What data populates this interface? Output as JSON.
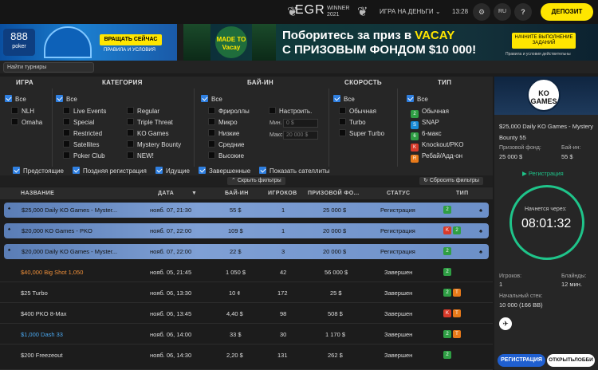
{
  "header": {
    "egr_title": "EGR",
    "egr_winner": "WINNER",
    "egr_year": "2021",
    "play_money": "ИГРА НА ДЕНЬГИ",
    "time": "13:28",
    "lang": "RU",
    "help": "?",
    "deposit": "ДЕПОЗИТ"
  },
  "banner_left": {
    "logo_text": "888",
    "logo_sub": "poker",
    "button": "ВРАЩАТЬ СЕЙЧАС",
    "rules": "ПРАВИЛА И УСЛОВИЯ"
  },
  "banner_right": {
    "badge": "MADE TO Vacay",
    "line1_a": "Поборитесь за приз в ",
    "line1_b": "VACAY",
    "line2": "С ПРИЗОВЫМ ФОНДОМ $10 000!",
    "button": "НАЧНИТЕ ВЫПОЛНЕНИЕ ЗАДАНИЙ",
    "small": "Правила и условия действительны"
  },
  "search": {
    "placeholder": "Найти турниры"
  },
  "filters": {
    "headers": {
      "game": "ИГРА",
      "category": "КАТЕГОРИЯ",
      "buyin": "БАЙ-ИН",
      "speed": "СКОРОСТЬ",
      "type": "ТИП"
    },
    "game": {
      "all": "Все",
      "nlh": "NLH",
      "omaha": "Omaha"
    },
    "category": {
      "all": "Все",
      "live": "Live Events",
      "special": "Special",
      "restricted": "Restricted",
      "satellites": "Satellites",
      "poker_club": "Poker Club",
      "regular": "Regular",
      "triple": "Triple Threat",
      "ko": "KO Games",
      "mystery": "Mystery Bounty",
      "new": "NEW!"
    },
    "buyin": {
      "all": "Все",
      "freeroll": "Фрироллы",
      "micro": "Микро",
      "low": "Низкие",
      "mid": "Средние",
      "high": "Высокие",
      "custom": "Настроить.",
      "min_label": "Мин.",
      "min_value": "0 $",
      "max_label": "Макс.",
      "max_value": "20 000 $"
    },
    "speed": {
      "all": "Все",
      "normal": "Обычная",
      "turbo": "Turbo",
      "super": "Super Turbo"
    },
    "type": {
      "all": "Все",
      "normal": "Обычная",
      "snap": "SNAP",
      "six": "6-макс",
      "knockout": "Knockout/PKO",
      "rebuy": "Ребай/Адд-он"
    },
    "bottom": {
      "upcoming": "Предстоящие",
      "late": "Поздняя регистрация",
      "running": "Идущие",
      "finished": "Завершенные",
      "satellites": "Показать сателлиты"
    },
    "hide": "Скрыть фильтры",
    "reset": "Сбросить фильтры"
  },
  "table": {
    "columns": {
      "name": "НАЗВАНИЕ",
      "date": "ДАТА",
      "buyin": "БАЙ-ИН",
      "players": "ИГРОКОВ",
      "prize": "ПРИЗОВОЙ ФО...",
      "status": "СТАТУС",
      "type": "ТИП"
    },
    "rows": [
      {
        "name": "$25,000 Daily KO Games - Myster...",
        "date": "нояб. 07, 21:30",
        "buyin": "55 $",
        "players": "1",
        "prize": "25 000 $",
        "status": "Регистрация"
      },
      {
        "name": "$20,000 KO Games - PKO",
        "date": "нояб. 07, 22:00",
        "buyin": "109 $",
        "players": "1",
        "prize": "20 000 $",
        "status": "Регистрация"
      },
      {
        "name": "$20,000 Daily KO Games - Myster...",
        "date": "нояб. 07, 22:00",
        "buyin": "22 $",
        "players": "3",
        "prize": "20 000 $",
        "status": "Регистрация"
      },
      {
        "name": "$40,000 Big Shot 1,050",
        "date": "нояб. 05, 21:45",
        "buyin": "1 050 $",
        "players": "42",
        "prize": "56 000 $",
        "status": "Завершен"
      },
      {
        "name": "$25 Turbo",
        "date": "нояб. 06, 13:30",
        "buyin": "10 ¢",
        "players": "172",
        "prize": "25 $",
        "status": "Завершен"
      },
      {
        "name": "$400 PKO 8-Max",
        "date": "нояб. 06, 13:45",
        "buyin": "4,40 $",
        "players": "98",
        "prize": "508 $",
        "status": "Завершен"
      },
      {
        "name": "$1,000 Dash 33",
        "date": "нояб. 06, 14:00",
        "buyin": "33 $",
        "players": "30",
        "prize": "1 170 $",
        "status": "Завершен"
      },
      {
        "name": "$200 Freezeout",
        "date": "нояб. 06, 14:30",
        "buyin": "2,20 $",
        "players": "131",
        "prize": "262 $",
        "status": "Завершен"
      }
    ]
  },
  "side": {
    "logo": "KO GAMES",
    "title": "$25,000 Daily KO Games - Mystery Bounty 55",
    "prize_label": "Призовой фонд:",
    "prize_value": "25 000 $",
    "buyin_label": "Бай-ин:",
    "buyin_value": "55 $",
    "reg_label": "Регистрация",
    "starts_label": "Начнется через:",
    "countdown": "08:01:32",
    "players_label": "Игроков:",
    "players_value": "1",
    "blinds_label": "Блайнды:",
    "blinds_value": "12 мин.",
    "stack_label": "Начальный стек:",
    "stack_value": "10 000 (166 BB)",
    "register_btn": "РЕГИСТРАЦИЯ",
    "open_btn": "ОТКРЫТЬЛОББИ"
  },
  "colors": {
    "accent_yellow": "#ffe600",
    "accent_blue": "#2f7fe0",
    "timer_green": "#1fc48a",
    "orange_name": "#f0903a",
    "blue_name": "#4aa8f0"
  }
}
